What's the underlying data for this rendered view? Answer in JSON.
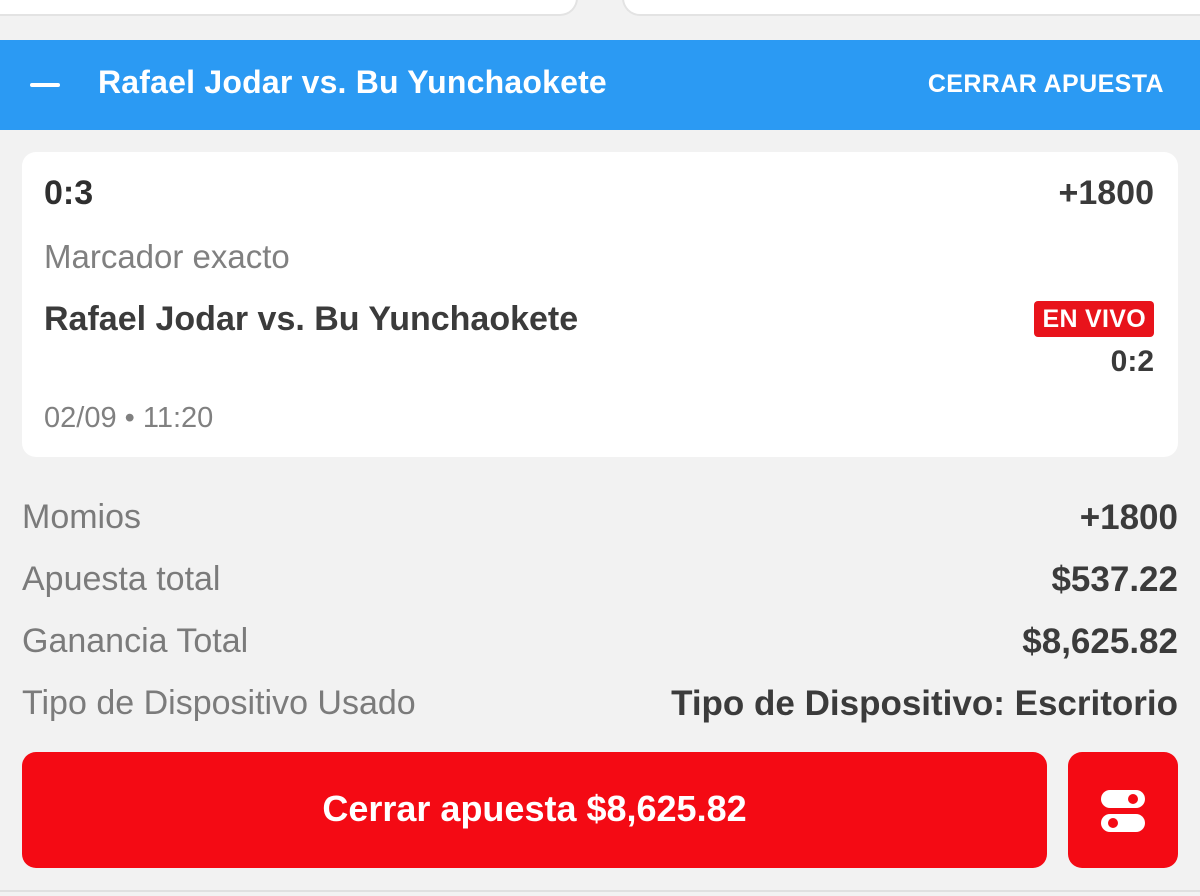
{
  "header": {
    "match_title": "Rafael Jodar vs. Bu Yunchaokete",
    "close_bet_label": "CERRAR APUESTA",
    "collapse_icon": "minus-icon",
    "background_color": "#2b9af3"
  },
  "selection": {
    "pick": "0:3",
    "odds": "+1800",
    "market": "Marcador exacto",
    "event": "Rafael Jodar vs. Bu Yunchaokete",
    "live_badge": "EN VIVO",
    "live_score": "0:2",
    "date_time": "02/09 • 11:20"
  },
  "summary": {
    "rows": [
      {
        "label": "Momios",
        "value": "+1800"
      },
      {
        "label": "Apuesta total",
        "value": "$537.22"
      },
      {
        "label": "Ganancia Total",
        "value": "$8,625.82"
      },
      {
        "label": "Tipo de Dispositivo Usado",
        "value": "Tipo de Dispositivo: Escritorio"
      }
    ]
  },
  "cashout": {
    "label": "Cerrar apuesta $8,625.82",
    "button_color": "#f40a14",
    "settings_icon": "toggle-settings-icon"
  }
}
